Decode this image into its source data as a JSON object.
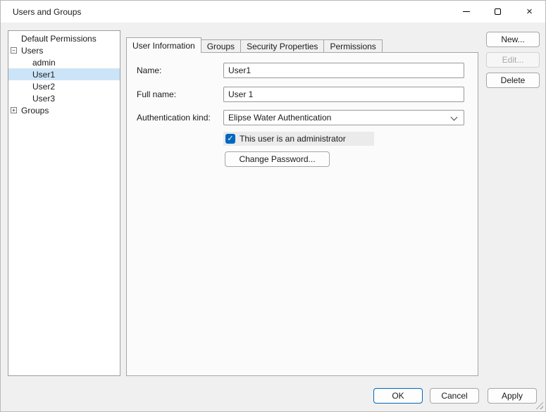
{
  "window": {
    "title": "Users and Groups"
  },
  "icons": {
    "close": "×",
    "check": "✓"
  },
  "colors": {
    "accent": "#0067c0",
    "tree_selection": "#cce4f7"
  },
  "tree": {
    "items": [
      {
        "label": "Default Permissions",
        "level": 0,
        "expander": "",
        "selected": false
      },
      {
        "label": "Users",
        "level": 0,
        "expander": "−",
        "selected": false
      },
      {
        "label": "admin",
        "level": 1,
        "expander": "",
        "selected": false
      },
      {
        "label": "User1",
        "level": 1,
        "expander": "",
        "selected": true
      },
      {
        "label": "User2",
        "level": 1,
        "expander": "",
        "selected": false
      },
      {
        "label": "User3",
        "level": 1,
        "expander": "",
        "selected": false
      },
      {
        "label": "Groups",
        "level": 0,
        "expander": "+",
        "selected": false
      }
    ]
  },
  "side_buttons": [
    {
      "label": "New...",
      "enabled": true
    },
    {
      "label": "Edit...",
      "enabled": false
    },
    {
      "label": "Delete",
      "enabled": true
    }
  ],
  "tabs": [
    {
      "label": "User Information",
      "active": true
    },
    {
      "label": "Groups",
      "active": false
    },
    {
      "label": "Security Properties",
      "active": false
    },
    {
      "label": "Permissions",
      "active": false
    }
  ],
  "form": {
    "name_label": "Name:",
    "name_value": "User1",
    "full_name_label": "Full name:",
    "full_name_value": "User 1",
    "auth_label": "Authentication kind:",
    "auth_value": "Elipse Water Authentication",
    "admin_checkbox_label": "This user is an administrator",
    "admin_checked": true,
    "change_password_label": "Change Password..."
  },
  "footer": {
    "ok_label": "OK",
    "cancel_label": "Cancel",
    "apply_label": "Apply"
  }
}
